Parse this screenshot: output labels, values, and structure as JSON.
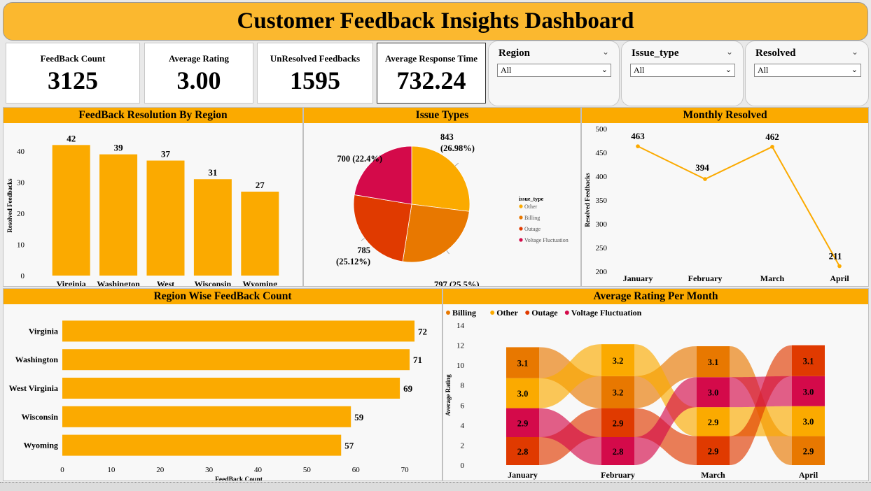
{
  "header": {
    "title": "Customer Feedback Insights Dashboard"
  },
  "kpis": [
    {
      "label": "FeedBack Count",
      "value": "3125"
    },
    {
      "label": "Average Rating",
      "value": "3.00"
    },
    {
      "label": "UnResolved Feedbacks",
      "value": "1595"
    },
    {
      "label": "Average Response Time",
      "value": "732.24"
    }
  ],
  "slicers": [
    {
      "title": "Region",
      "selected": "All"
    },
    {
      "title": "Issue_type",
      "selected": "All"
    },
    {
      "title": "Resolved",
      "selected": "All"
    }
  ],
  "panels": {
    "resolution_by_region": "FeedBack Resolution By Region",
    "issue_types": "Issue Types",
    "monthly_resolved": "Monthly Resolved",
    "region_wise_count": "Region Wise FeedBack Count",
    "avg_rating_month": "Average Rating Per Month"
  },
  "colors": {
    "accent": "#fbaa00",
    "title_bg": "#fbb82f",
    "Other": "#fbaa00",
    "Billing": "#e87800",
    "Outage": "#e03a00",
    "Voltage Fluctuation": "#d40a4a"
  },
  "chart_data": [
    {
      "id": "resolution_by_region",
      "type": "bar",
      "categories": [
        "Virginia",
        "Washington",
        "West Virginia",
        "Wisconsin",
        "Wyoming"
      ],
      "category_lines": [
        [
          "Virginia"
        ],
        [
          "Washington"
        ],
        [
          "West",
          "Virginia"
        ],
        [
          "Wisconsin"
        ],
        [
          "Wyoming"
        ]
      ],
      "values": [
        42,
        39,
        37,
        31,
        27
      ],
      "ylabel": "Resolved Feedbacks",
      "yticks": [
        0,
        10,
        20,
        30,
        40
      ],
      "ylim": [
        0,
        45
      ]
    },
    {
      "id": "issue_types",
      "type": "pie",
      "legend_title": "issue_type",
      "legend": [
        "Other",
        "Billing",
        "Outage",
        "Voltage Fluctuation"
      ],
      "slices": [
        {
          "name": "Other",
          "value": 843,
          "label": [
            "843",
            "(26.98%)"
          ]
        },
        {
          "name": "Billing",
          "value": 797,
          "label": [
            "797 (25.5%)"
          ]
        },
        {
          "name": "Outage",
          "value": 785,
          "label": [
            "785",
            "(25.12%)"
          ]
        },
        {
          "name": "Voltage Fluctuation",
          "value": 700,
          "label": [
            "700 (22.4%)"
          ]
        }
      ]
    },
    {
      "id": "monthly_resolved",
      "type": "line",
      "categories": [
        "January",
        "February",
        "March",
        "April"
      ],
      "values": [
        463,
        394,
        462,
        211
      ],
      "ylabel": "Resolved Feedbacks",
      "yticks": [
        200,
        250,
        300,
        350,
        400,
        450,
        500
      ],
      "ylim": [
        200,
        500
      ]
    },
    {
      "id": "region_wise_count",
      "type": "bar",
      "orientation": "horizontal",
      "categories": [
        "Virginia",
        "Washington",
        "West Virginia",
        "Wisconsin",
        "Wyoming"
      ],
      "values": [
        72,
        71,
        69,
        59,
        57
      ],
      "xlabel": "FeedBack Count",
      "xticks": [
        0,
        10,
        20,
        30,
        40,
        50,
        60,
        70
      ],
      "xlim": [
        0,
        75
      ]
    },
    {
      "id": "avg_rating_month",
      "type": "ribbon",
      "categories": [
        "January",
        "February",
        "March",
        "April"
      ],
      "legend": [
        "Billing",
        "Other",
        "Outage",
        "Voltage Fluctuation"
      ],
      "ylabel": "Average Rating",
      "yticks": [
        0,
        2,
        4,
        6,
        8,
        10,
        12,
        14
      ],
      "ylim": [
        0,
        14
      ],
      "stacks": [
        [
          {
            "name": "Outage",
            "value": 2.8,
            "label": "2.8"
          },
          {
            "name": "Voltage Fluctuation",
            "value": 2.9,
            "label": "2.9"
          },
          {
            "name": "Other",
            "value": 3.0,
            "label": "3.0"
          },
          {
            "name": "Billing",
            "value": 3.1,
            "label": "3.1"
          }
        ],
        [
          {
            "name": "Voltage Fluctuation",
            "value": 2.8,
            "label": "2.8"
          },
          {
            "name": "Outage",
            "value": 2.9,
            "label": "2.9"
          },
          {
            "name": "Billing",
            "value": 3.2,
            "label": "3.2"
          },
          {
            "name": "Other",
            "value": 3.2,
            "label": "3.2"
          }
        ],
        [
          {
            "name": "Outage",
            "value": 2.9,
            "label": "2.9"
          },
          {
            "name": "Other",
            "value": 2.9,
            "label": "2.9"
          },
          {
            "name": "Voltage Fluctuation",
            "value": 3.0,
            "label": "3.0"
          },
          {
            "name": "Billing",
            "value": 3.1,
            "label": "3.1"
          }
        ],
        [
          {
            "name": "Billing",
            "value": 2.9,
            "label": "2.9"
          },
          {
            "name": "Other",
            "value": 3.0,
            "label": "3.0"
          },
          {
            "name": "Voltage Fluctuation",
            "value": 3.0,
            "label": "3.0"
          },
          {
            "name": "Outage",
            "value": 3.1,
            "label": "3.1"
          }
        ]
      ]
    }
  ]
}
